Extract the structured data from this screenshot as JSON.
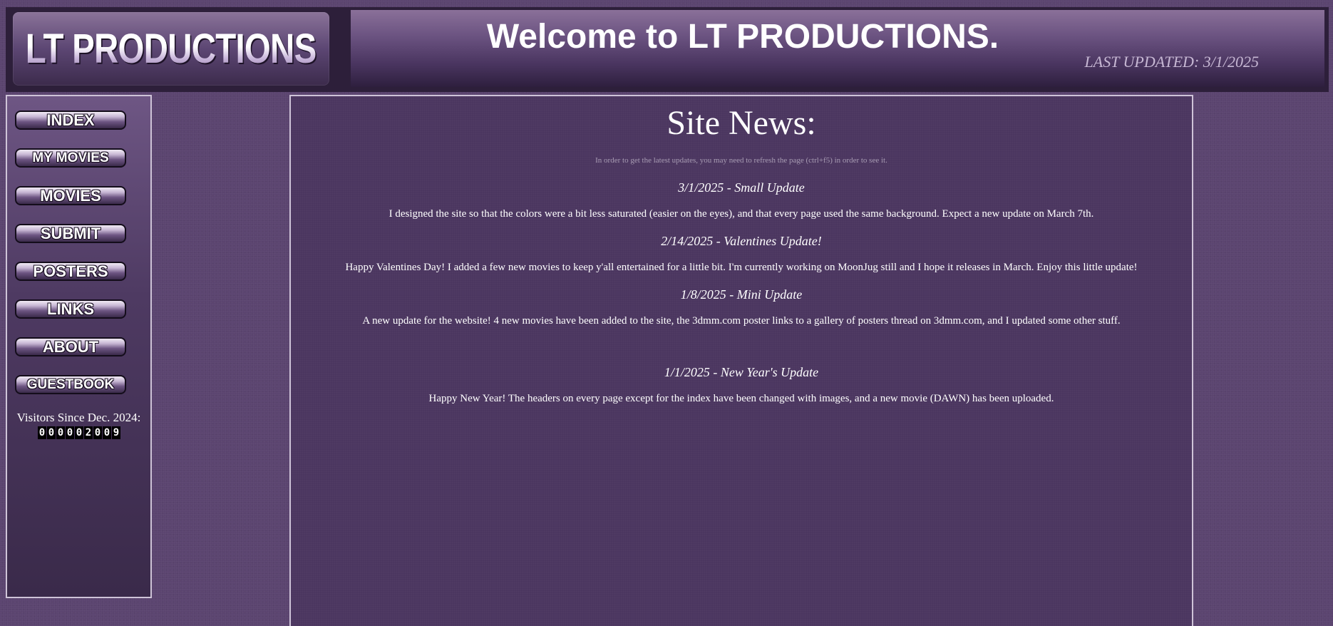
{
  "header": {
    "logo_text": "LT PRODUCTIONS",
    "welcome": "Welcome to LT PRODUCTIONS.",
    "last_updated": "LAST UPDATED: 3/1/2025"
  },
  "nav": {
    "items": [
      "INDEX",
      "MY MOVIES",
      "MOVIES",
      "SUBMIT",
      "POSTERS",
      "LINKS",
      "ABOUT",
      "GUESTBOOK"
    ]
  },
  "visitors": {
    "label": "Visitors Since Dec. 2024:",
    "digits": [
      "0",
      "0",
      "0",
      "0",
      "0",
      "2",
      "0",
      "0",
      "9"
    ]
  },
  "news": {
    "title": "Site News:",
    "note": "In order to get the latest updates, you may need to refresh the page (ctrl+f5) in order to see it.",
    "entries": [
      {
        "heading": "3/1/2025 - Small Update",
        "body": "I designed the site so that the colors were a bit less saturated (easier on the eyes), and that every page used the same background. Expect a new update on March 7th."
      },
      {
        "heading": "2/14/2025 - Valentines Update!",
        "body": "Happy Valentines Day! I added a few new movies to keep y'all entertained for a little bit. I'm currently working on MoonJug still and I hope it releases in March. Enjoy this little update!"
      },
      {
        "heading": "1/8/2025 - Mini Update",
        "body": "A new update for the website! 4 new movies have been added to the site, the 3dmm.com poster links to a gallery of posters thread on 3dmm.com, and I updated some other stuff."
      },
      {
        "heading": "1/1/2025 - New Year's Update",
        "body": "Happy New Year! The headers on every page except for the index have been changed with images, and a new movie (DAWN) has been uploaded."
      }
    ]
  },
  "colors": {
    "background": "#5b4470",
    "panel": "#4b3660",
    "border": "#cfc4d8"
  }
}
